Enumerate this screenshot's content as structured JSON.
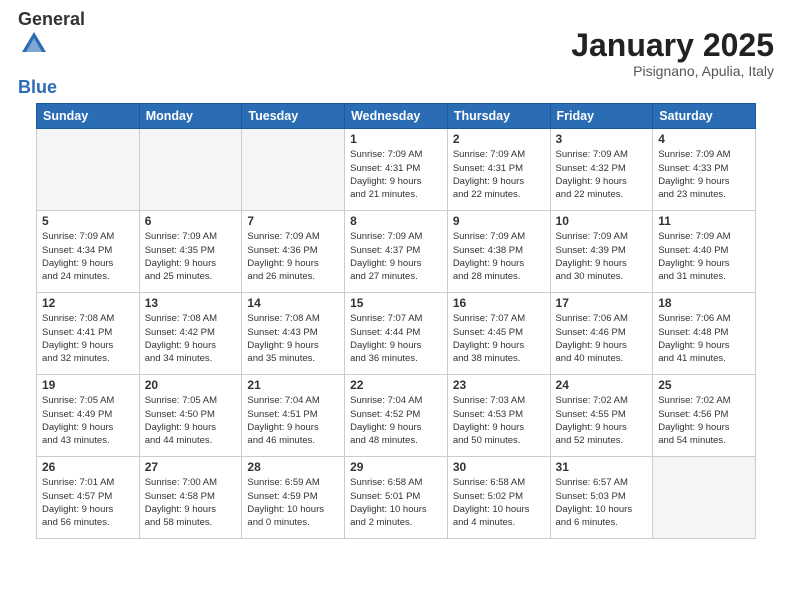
{
  "header": {
    "logo_general": "General",
    "logo_blue": "Blue",
    "month": "January 2025",
    "location": "Pisignano, Apulia, Italy"
  },
  "weekdays": [
    "Sunday",
    "Monday",
    "Tuesday",
    "Wednesday",
    "Thursday",
    "Friday",
    "Saturday"
  ],
  "weeks": [
    [
      {
        "day": "",
        "info": ""
      },
      {
        "day": "",
        "info": ""
      },
      {
        "day": "",
        "info": ""
      },
      {
        "day": "1",
        "info": "Sunrise: 7:09 AM\nSunset: 4:31 PM\nDaylight: 9 hours\nand 21 minutes."
      },
      {
        "day": "2",
        "info": "Sunrise: 7:09 AM\nSunset: 4:31 PM\nDaylight: 9 hours\nand 22 minutes."
      },
      {
        "day": "3",
        "info": "Sunrise: 7:09 AM\nSunset: 4:32 PM\nDaylight: 9 hours\nand 22 minutes."
      },
      {
        "day": "4",
        "info": "Sunrise: 7:09 AM\nSunset: 4:33 PM\nDaylight: 9 hours\nand 23 minutes."
      }
    ],
    [
      {
        "day": "5",
        "info": "Sunrise: 7:09 AM\nSunset: 4:34 PM\nDaylight: 9 hours\nand 24 minutes."
      },
      {
        "day": "6",
        "info": "Sunrise: 7:09 AM\nSunset: 4:35 PM\nDaylight: 9 hours\nand 25 minutes."
      },
      {
        "day": "7",
        "info": "Sunrise: 7:09 AM\nSunset: 4:36 PM\nDaylight: 9 hours\nand 26 minutes."
      },
      {
        "day": "8",
        "info": "Sunrise: 7:09 AM\nSunset: 4:37 PM\nDaylight: 9 hours\nand 27 minutes."
      },
      {
        "day": "9",
        "info": "Sunrise: 7:09 AM\nSunset: 4:38 PM\nDaylight: 9 hours\nand 28 minutes."
      },
      {
        "day": "10",
        "info": "Sunrise: 7:09 AM\nSunset: 4:39 PM\nDaylight: 9 hours\nand 30 minutes."
      },
      {
        "day": "11",
        "info": "Sunrise: 7:09 AM\nSunset: 4:40 PM\nDaylight: 9 hours\nand 31 minutes."
      }
    ],
    [
      {
        "day": "12",
        "info": "Sunrise: 7:08 AM\nSunset: 4:41 PM\nDaylight: 9 hours\nand 32 minutes."
      },
      {
        "day": "13",
        "info": "Sunrise: 7:08 AM\nSunset: 4:42 PM\nDaylight: 9 hours\nand 34 minutes."
      },
      {
        "day": "14",
        "info": "Sunrise: 7:08 AM\nSunset: 4:43 PM\nDaylight: 9 hours\nand 35 minutes."
      },
      {
        "day": "15",
        "info": "Sunrise: 7:07 AM\nSunset: 4:44 PM\nDaylight: 9 hours\nand 36 minutes."
      },
      {
        "day": "16",
        "info": "Sunrise: 7:07 AM\nSunset: 4:45 PM\nDaylight: 9 hours\nand 38 minutes."
      },
      {
        "day": "17",
        "info": "Sunrise: 7:06 AM\nSunset: 4:46 PM\nDaylight: 9 hours\nand 40 minutes."
      },
      {
        "day": "18",
        "info": "Sunrise: 7:06 AM\nSunset: 4:48 PM\nDaylight: 9 hours\nand 41 minutes."
      }
    ],
    [
      {
        "day": "19",
        "info": "Sunrise: 7:05 AM\nSunset: 4:49 PM\nDaylight: 9 hours\nand 43 minutes."
      },
      {
        "day": "20",
        "info": "Sunrise: 7:05 AM\nSunset: 4:50 PM\nDaylight: 9 hours\nand 44 minutes."
      },
      {
        "day": "21",
        "info": "Sunrise: 7:04 AM\nSunset: 4:51 PM\nDaylight: 9 hours\nand 46 minutes."
      },
      {
        "day": "22",
        "info": "Sunrise: 7:04 AM\nSunset: 4:52 PM\nDaylight: 9 hours\nand 48 minutes."
      },
      {
        "day": "23",
        "info": "Sunrise: 7:03 AM\nSunset: 4:53 PM\nDaylight: 9 hours\nand 50 minutes."
      },
      {
        "day": "24",
        "info": "Sunrise: 7:02 AM\nSunset: 4:55 PM\nDaylight: 9 hours\nand 52 minutes."
      },
      {
        "day": "25",
        "info": "Sunrise: 7:02 AM\nSunset: 4:56 PM\nDaylight: 9 hours\nand 54 minutes."
      }
    ],
    [
      {
        "day": "26",
        "info": "Sunrise: 7:01 AM\nSunset: 4:57 PM\nDaylight: 9 hours\nand 56 minutes."
      },
      {
        "day": "27",
        "info": "Sunrise: 7:00 AM\nSunset: 4:58 PM\nDaylight: 9 hours\nand 58 minutes."
      },
      {
        "day": "28",
        "info": "Sunrise: 6:59 AM\nSunset: 4:59 PM\nDaylight: 10 hours\nand 0 minutes."
      },
      {
        "day": "29",
        "info": "Sunrise: 6:58 AM\nSunset: 5:01 PM\nDaylight: 10 hours\nand 2 minutes."
      },
      {
        "day": "30",
        "info": "Sunrise: 6:58 AM\nSunset: 5:02 PM\nDaylight: 10 hours\nand 4 minutes."
      },
      {
        "day": "31",
        "info": "Sunrise: 6:57 AM\nSunset: 5:03 PM\nDaylight: 10 hours\nand 6 minutes."
      },
      {
        "day": "",
        "info": ""
      }
    ]
  ]
}
